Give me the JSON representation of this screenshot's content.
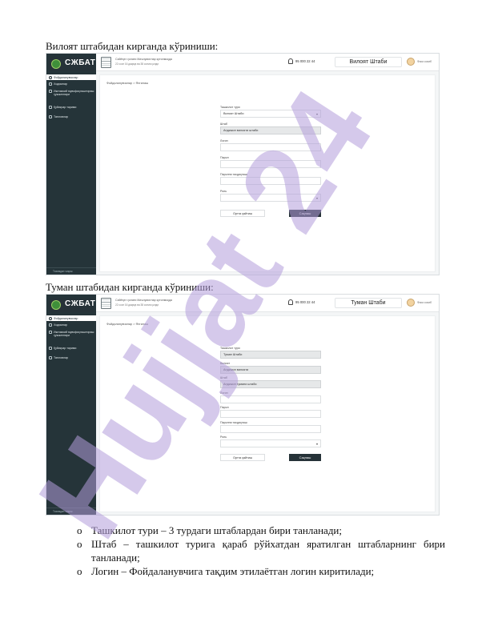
{
  "captions": {
    "first": "Вилоят штабидан кирганда кўриниши:",
    "second": "Туман штабидан кирганда кўриниши:"
  },
  "app": {
    "logo_text": "СЖБАТ",
    "topbar_line1": "Сайёҳат ҳолати Маълумотлар кутилмоқда",
    "topbar_line2": "22 соат 16 дақиқа ва 38 сония қолди",
    "phone": "95 000 22 44",
    "user_name": "Фоиз сохиб",
    "nav": [
      {
        "label": "Фойдаланувчилар",
        "icon": "users-icon"
      },
      {
        "label": "Ходимлар",
        "icon": "person-icon"
      },
      {
        "label": "Ижтимоий мувофиқлаштириш ҳужжатлари",
        "icon": "link-icon"
      },
      {
        "label": "Қуйиқсар тарими",
        "icon": "calendar-icon"
      },
      {
        "label": "Танловлар",
        "icon": "user-check-icon"
      }
    ],
    "sidebar_footer": "Тизимдан чиқиш",
    "breadcrumb": "Фойдаланувчилар > Янгилаш"
  },
  "screens": [
    {
      "hq_title": "Вилоят Штаби",
      "fields": [
        {
          "label": "Ташкилот тури",
          "value": "Вилоят Штаби",
          "style": "select"
        },
        {
          "label": "Штаб",
          "value": "Андижон вилояти штаби",
          "style": "grey"
        },
        {
          "label": "Логин",
          "value": "",
          "style": "plain"
        },
        {
          "label": "Парол",
          "value": "",
          "style": "plain"
        },
        {
          "label": "Паролни тасдиқлаш",
          "value": "",
          "style": "plain"
        },
        {
          "label": "Роль",
          "value": "",
          "style": "select"
        }
      ],
      "back_label": "Ортга қайтиш",
      "save_label": "Сақлаш"
    },
    {
      "hq_title": "Туман Штаби",
      "fields": [
        {
          "label": "Ташкилот тури",
          "value": "Туман Штаби",
          "style": "grey"
        },
        {
          "label": "Вилоят",
          "value": "Андижон вилояти",
          "style": "grey"
        },
        {
          "label": "Штаб",
          "value": "Андижон тумани штаби",
          "style": "grey"
        },
        {
          "label": "Логин",
          "value": "",
          "style": "plain"
        },
        {
          "label": "Парол",
          "value": "",
          "style": "plain"
        },
        {
          "label": "Паролни тасдиқлаш",
          "value": "",
          "style": "plain"
        },
        {
          "label": "Роль",
          "value": "",
          "style": "select"
        }
      ],
      "back_label": "Ортга қайтиш",
      "save_label": "Сақлаш"
    }
  ],
  "bullets": {
    "marker": "o",
    "items": [
      "Ташкилот тури – 3 турдаги штаблардан бири танланади;",
      "Штаб – ташкилот турига қараб рўйхатдан яратилган штабларнинг бири танланади;",
      "Логин – Фойдаланувчига тақдим этилаётган логин киритилади;"
    ]
  },
  "watermark": {
    "text": "Hujjat 24",
    "color": "#b39ddb"
  }
}
